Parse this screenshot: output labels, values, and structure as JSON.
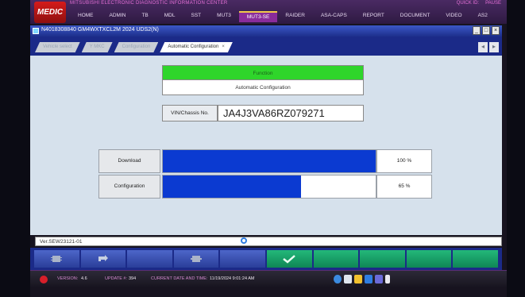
{
  "app": {
    "logo_text": "MEDIC",
    "title": "MITSUBISHI  ELECTRONIC  DIAGNOSTIC  INFORMATION  CENTER",
    "help_links": [
      "QUICK ID:",
      "PAUSE"
    ],
    "menu": [
      "HOME",
      "ADMIN",
      "TB",
      "MDL",
      "SST",
      "MUT3",
      "MUT3-SE",
      "RAIDER",
      "ASA-CAPS",
      "REPORT",
      "DOCUMENT",
      "VIDEO",
      "AS2"
    ]
  },
  "window": {
    "title": "N4018308840  GM4WXTXCL2M 2024   UDS2(N)",
    "buttons": [
      "_",
      "□",
      "×"
    ]
  },
  "tabs": {
    "items": [
      "Vehicle select",
      "Y MKC",
      "Configuration",
      "Automatic Configuration"
    ],
    "close_glyph": "×",
    "right_icons": [
      "◂",
      "▸"
    ]
  },
  "main": {
    "function_title": "Function",
    "function_subtitle": "Automatic Configuration",
    "vin_label": "VIN/Chassis No.",
    "vin_value": "JA4J3VA86RZ079271",
    "progress": [
      {
        "label": "Download",
        "percent": 100,
        "value_text": "100 %"
      },
      {
        "label": "Configuration",
        "percent": 65,
        "value_text": "65 %"
      }
    ]
  },
  "version_bar": {
    "version_text": "Ver.SEW23121-01"
  },
  "toolbar": {
    "icons": [
      "ecu-icon",
      "back-icon",
      "",
      "ecu2-icon",
      "",
      "check-icon",
      "",
      "",
      "",
      ""
    ]
  },
  "status": {
    "version_label": "VERSION:",
    "version_value": "4.6",
    "update_label": "UPDATE #:",
    "update_value": "394",
    "datetime_label": "CURRENT DATE AND TIME:",
    "datetime_value": "11/19/2024 9:01:24 AM"
  },
  "colors": {
    "function_green": "#2fd52b",
    "progress_blue": "#0b3ad1",
    "toolbar_blue": "#1b2a88",
    "confirm_green": "#0f8656"
  }
}
